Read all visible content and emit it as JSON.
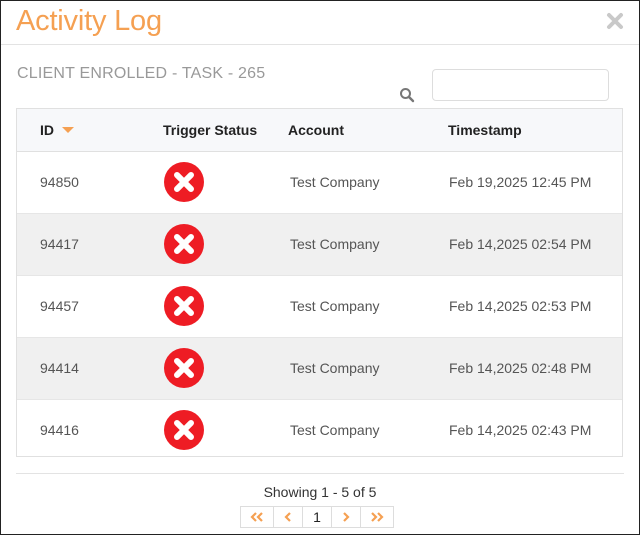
{
  "dialog": {
    "title": "Activity Log",
    "subtitle": "CLIENT ENROLLED - TASK - 265",
    "close_icon": "close-icon"
  },
  "search": {
    "value": "",
    "placeholder": "",
    "icon": "search-icon"
  },
  "table": {
    "columns": {
      "id": "ID",
      "trigger_status": "Trigger Status",
      "account": "Account",
      "timestamp": "Timestamp"
    },
    "sort": {
      "column": "id",
      "direction": "descending"
    },
    "rows": [
      {
        "id": "94850",
        "status": "failed",
        "account": "Test Company",
        "timestamp": "Feb 19,2025 12:45 PM"
      },
      {
        "id": "94417",
        "status": "failed",
        "account": "Test Company",
        "timestamp": "Feb 14,2025 02:54 PM"
      },
      {
        "id": "94457",
        "status": "failed",
        "account": "Test Company",
        "timestamp": "Feb 14,2025 02:53 PM"
      },
      {
        "id": "94414",
        "status": "failed",
        "account": "Test Company",
        "timestamp": "Feb 14,2025 02:48 PM"
      },
      {
        "id": "94416",
        "status": "failed",
        "account": "Test Company",
        "timestamp": "Feb 14,2025 02:43 PM"
      }
    ]
  },
  "pagination": {
    "summary": "Showing 1 - 5 of 5",
    "current_page": "1"
  },
  "colors": {
    "accent": "#f5a052",
    "status_failed": "#ee1c24",
    "row_alt": "#f0f0f0"
  }
}
